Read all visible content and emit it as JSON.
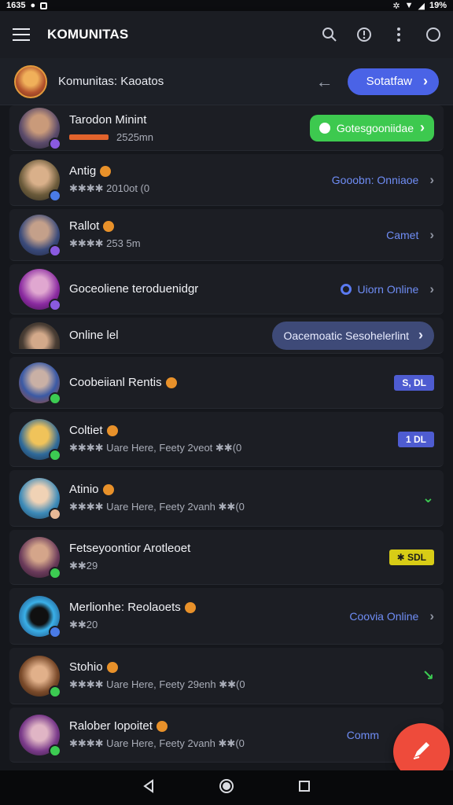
{
  "status_bar": {
    "time": "1635",
    "battery": "19%"
  },
  "app_bar": {
    "title": "KOMUNITAS"
  },
  "community": {
    "name": "Komunitas: Kaoatos",
    "follow_label": "Sotatfaw"
  },
  "rows": [
    {
      "name": "Tarodon Minint",
      "sub": "2525mn",
      "action_label": "Gotesgooniidae",
      "action_type": "green-pill"
    },
    {
      "name": "Antig",
      "sub": "✱✱✱✱  2010ot (0",
      "action_label": "Gooobn: Onniaoe",
      "action_type": "link"
    },
    {
      "name": "Rallot",
      "sub": "✱✱✱✱  253 5m",
      "action_label": "Camet",
      "action_type": "link"
    },
    {
      "name": "Goceoliene teroduenidgr",
      "sub": "",
      "action_label": "Uiorn Online",
      "action_type": "link-dot"
    },
    {
      "name": "Online lel",
      "sub": "",
      "action_label": "Oacemoatic Sesohelerlint",
      "action_type": "wide-pill"
    },
    {
      "name": "Coobeiianl Rentis",
      "sub": "",
      "action_label": "S, DL",
      "action_type": "tag-blue"
    },
    {
      "name": "Coltiet",
      "sub": "✱✱✱✱  Uare Here, Feety 2veot ✱✱(0",
      "action_label": "1 DL",
      "action_type": "tag-blue"
    },
    {
      "name": "Atinio",
      "sub": "✱✱✱✱  Uare Here, Feety 2vanh ✱✱(0",
      "action_label": "",
      "action_type": "check"
    },
    {
      "name": "Fetseyoontior Arotleoet",
      "sub": "✱✱29",
      "action_label": "✱ SDL",
      "action_type": "tag-yellow"
    },
    {
      "name": "Merlionhe: Reolaoets",
      "sub": "✱✱20",
      "action_label": "Coovia Online",
      "action_type": "link"
    },
    {
      "name": "Stohio",
      "sub": "✱✱✱✱  Uare Here, Feety 29enh ✱✱(0",
      "action_label": "",
      "action_type": "check-arrow"
    },
    {
      "name": "Ralober Iopoitet",
      "sub": "✱✱✱✱  Uare Here, Feety 2vanh ✱✱(0",
      "action_label": "Comm",
      "action_type": "link-cut"
    }
  ],
  "colors": {
    "accent": "#4a63e6",
    "online": "#3ccb52",
    "fab": "#ee4b3b"
  },
  "icons": [
    "menu-icon",
    "search-icon",
    "info-icon",
    "more-vert-icon",
    "chat-icon",
    "back-arrow-icon",
    "chevron-right-icon",
    "edit-icon",
    "nav-back-icon",
    "nav-home-icon",
    "nav-recents-icon"
  ]
}
